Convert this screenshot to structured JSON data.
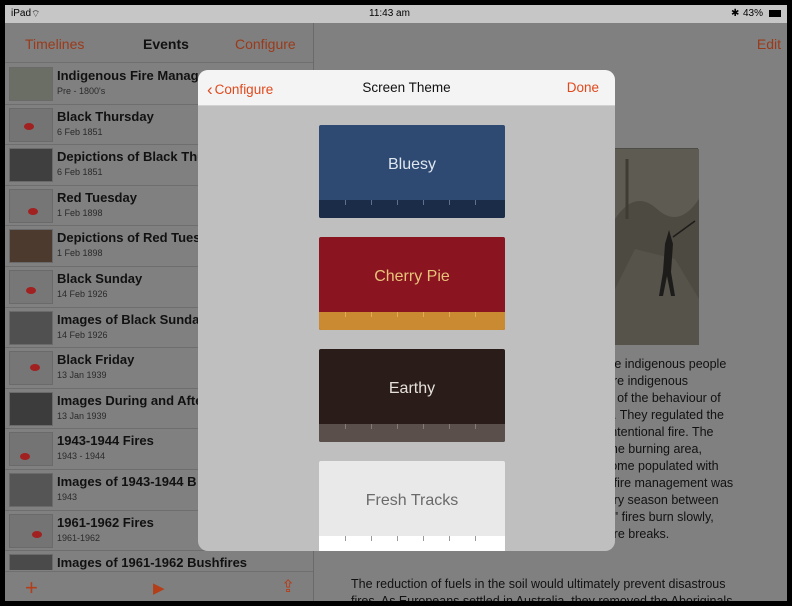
{
  "status_bar": {
    "device": "iPad",
    "time": "11:43 am",
    "battery": "43%"
  },
  "left_nav": {
    "back": "Timelines",
    "title": "Events",
    "action": "Configure"
  },
  "events": [
    {
      "title": "Indigenous Fire Manage",
      "date": "Pre - 1800's"
    },
    {
      "title": "Black Thursday",
      "date": "6 Feb 1851"
    },
    {
      "title": "Depictions of Black Thu",
      "date": "6 Feb 1851"
    },
    {
      "title": "Red Tuesday",
      "date": "1 Feb 1898"
    },
    {
      "title": "Depictions of Red Tuesc",
      "date": "1 Feb 1898"
    },
    {
      "title": "Black Sunday",
      "date": "14 Feb 1926"
    },
    {
      "title": "Images of Black Sunday",
      "date": "14 Feb 1926"
    },
    {
      "title": "Black Friday",
      "date": "13 Jan 1939"
    },
    {
      "title": "Images During and Afte",
      "date": "13 Jan 1939"
    },
    {
      "title": "1943-1944 Fires",
      "date": "1943 - 1944"
    },
    {
      "title": "Images of 1943-1944 B",
      "date": "1943"
    },
    {
      "title": "1961-1962 Fires",
      "date": "1961-1962"
    },
    {
      "title": "Images of 1961-1962 Bushfires",
      "date": "1961-1962"
    }
  ],
  "toolbar": {
    "add_icon": "+",
    "play_icon": "▶",
    "share_icon": "⇪"
  },
  "detail": {
    "edit_label": "Edit",
    "text_lines": [
      ", the indigenous people",
      "were indigenous",
      "ble of the behaviour of",
      "cts. They regulated the",
      "n intentional fire. The",
      "e the burning area,",
      "ecome populated with",
      "us fire management was",
      "y dry season between",
      "ool\" fires burn slowly,",
      "g fire breaks."
    ],
    "bottom_lines": [
      "The reduction of fuels in the soil would ultimately prevent disastrous",
      "fires. As Europeans settled in Australia, they removed the Aboriginals"
    ]
  },
  "modal": {
    "back_label": "Configure",
    "title": "Screen Theme",
    "done_label": "Done",
    "themes": [
      {
        "name": "Bluesy",
        "bg": "#2e4a72",
        "text": "#dfe6f0",
        "strip": "#1a2c47",
        "tick": "#5d7092"
      },
      {
        "name": "Cherry Pie",
        "bg": "#8a1420",
        "text": "#e8c37a",
        "strip": "#c98a32",
        "tick": "#e0ac58"
      },
      {
        "name": "Earthy",
        "bg": "#2a1d19",
        "text": "#e6e0da",
        "strip": "#5a4f4b",
        "tick": "#85797a"
      },
      {
        "name": "Fresh Tracks",
        "bg": "#e9e9e9",
        "text": "#6a6a6a",
        "strip": "#ffffff",
        "tick": "#9a9a9a"
      }
    ]
  },
  "colors": {
    "accent": "#e0491d",
    "dim_accent": "#9a3a1a"
  }
}
